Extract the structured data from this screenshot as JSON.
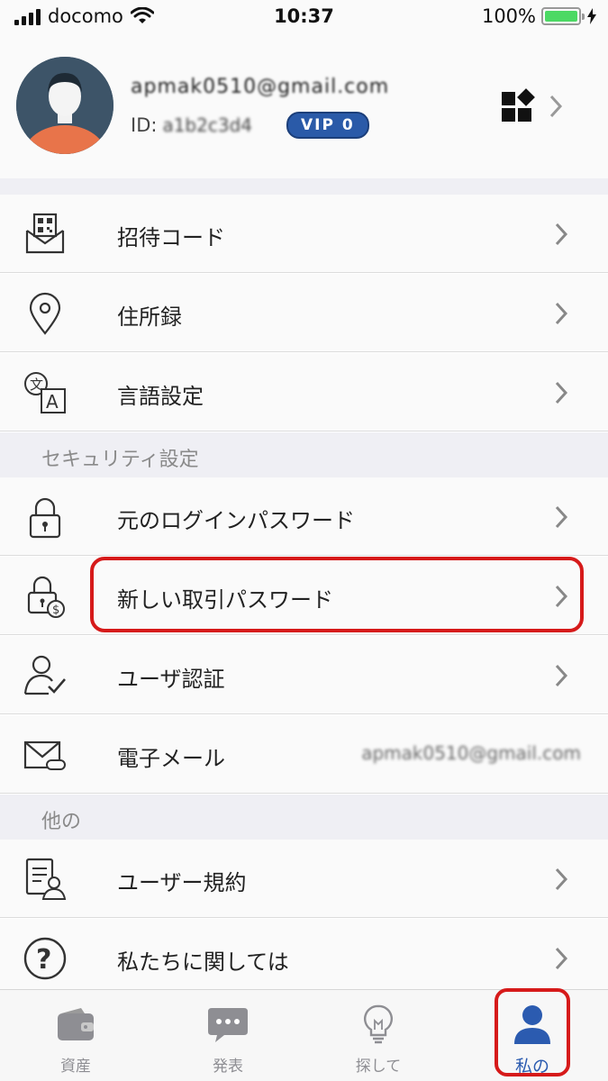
{
  "status_bar": {
    "carrier": "docomo",
    "time": "10:37",
    "battery": "100%"
  },
  "profile": {
    "email": "apmak0510@gmail.com",
    "id_label": "ID:",
    "id_value": "a1b2c3d4",
    "vip": "VIP 0"
  },
  "menu": {
    "invite_code": "招待コード",
    "address_book": "住所録",
    "language": "言語設定"
  },
  "security": {
    "header": "セキュリティ設定",
    "login_password": "元のログインパスワード",
    "trade_password": "新しい取引パスワード",
    "verification": "ユーザ認証",
    "email_label": "電子メール",
    "email_value": "apmak0510@gmail.com"
  },
  "other": {
    "header": "他の",
    "user_agreement": "ユーザー規約",
    "about": "私たちに関しては"
  },
  "tabs": [
    {
      "label": "資産",
      "icon": "wallet-icon"
    },
    {
      "label": "発表",
      "icon": "chat-bubble-icon"
    },
    {
      "label": "探して",
      "icon": "lightbulb-icon"
    },
    {
      "label": "私の",
      "icon": "person-icon",
      "active": true
    }
  ],
  "colors": {
    "accent": "#2b5bb0",
    "highlight": "#d61a1a",
    "inactive_tab": "#8e8e93"
  }
}
